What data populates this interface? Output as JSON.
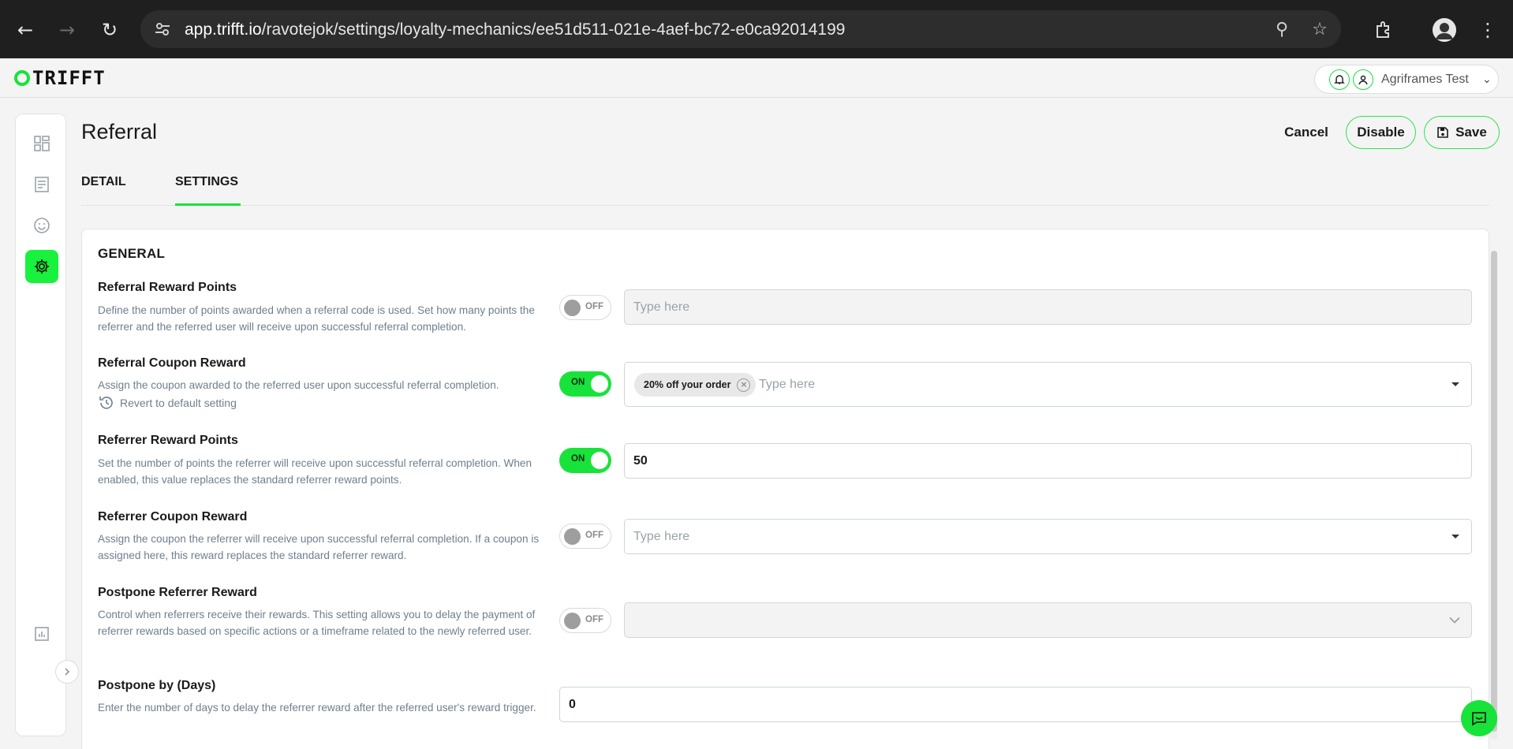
{
  "browser": {
    "url_host": "app.trifft.io",
    "url_path": "/ravotejok/settings/loyalty-mechanics/ee51d511-021e-4aef-bc72-e0ca92014199"
  },
  "app": {
    "logo_text": "TRIFFT",
    "account_name": "Agriframes Test",
    "accent_color": "#18e33a"
  },
  "page": {
    "title": "Referral",
    "actions": {
      "cancel": "Cancel",
      "disable": "Disable",
      "save": "Save"
    },
    "tabs": [
      {
        "label": "DETAIL",
        "active": false
      },
      {
        "label": "SETTINGS",
        "active": true
      }
    ]
  },
  "sidebar": {
    "items": [
      {
        "icon": "dashboard-grid-icon",
        "active": false
      },
      {
        "icon": "document-list-icon",
        "active": false
      },
      {
        "icon": "smiley-face-icon",
        "active": false
      },
      {
        "icon": "gear-icon",
        "active": true
      },
      {
        "icon": "bar-chart-icon",
        "active": false
      }
    ]
  },
  "general": {
    "title": "GENERAL",
    "fields": [
      {
        "label": "Referral Reward Points",
        "description": "Define the number of points awarded when a referral code is used. Set how many points the referrer and the referred user will receive upon successful referral completion.",
        "toggle": "OFF",
        "placeholder": "Type here",
        "value": ""
      },
      {
        "label": "Referral Coupon Reward",
        "description": "Assign the coupon awarded to the referred user upon successful referral completion.",
        "revert_label": "Revert to default setting",
        "toggle": "ON",
        "chip": "20% off your order",
        "placeholder": "Type here"
      },
      {
        "label": "Referrer Reward Points",
        "description": "Set the number of points the referrer will receive upon successful referral completion. When enabled, this value replaces the standard referrer reward points.",
        "toggle": "ON",
        "value": "50"
      },
      {
        "label": "Referrer Coupon Reward",
        "description": "Assign the coupon the referrer will receive upon successful referral completion. If a coupon is assigned here, this reward replaces the standard referrer reward.",
        "toggle": "OFF",
        "placeholder": "Type here"
      },
      {
        "label": "Postpone Referrer Reward",
        "description": "Control when referrers receive their rewards. This setting allows you to delay the payment of referrer rewards based on specific actions or a timeframe related to the newly referred user.",
        "toggle": "OFF",
        "value": ""
      },
      {
        "label": "Postpone by (Days)",
        "description": "Enter the number of days to delay the referrer reward after the referred user's reward trigger.",
        "value": "0"
      }
    ]
  }
}
